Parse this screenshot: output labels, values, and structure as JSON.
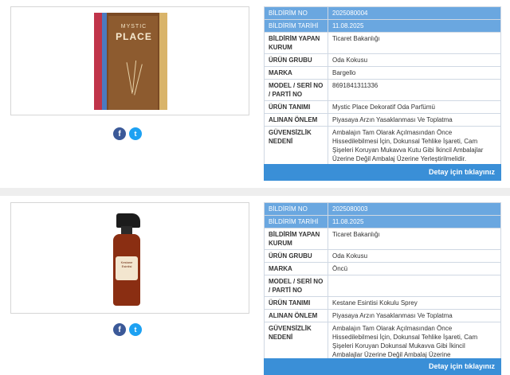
{
  "cards": [
    {
      "fields": [
        {
          "label": "BİLDİRİM NO",
          "value": "2025080004"
        },
        {
          "label": "BİLDİRİM TARİHİ",
          "value": "11.08.2025"
        },
        {
          "label": "BİLDİRİM YAPAN KURUM",
          "value": "Ticaret Bakanlığı"
        },
        {
          "label": "ÜRÜN GRUBU",
          "value": "Oda Kokusu"
        },
        {
          "label": "MARKA",
          "value": "Bargello"
        },
        {
          "label": "MODEL / SERİ NO / PARTİ NO",
          "value": "8691841311336"
        },
        {
          "label": "ÜRÜN TANIMI",
          "value": "Mystic Place Dekoratif Oda Parfümü"
        },
        {
          "label": "ALINAN ÖNLEM",
          "value": "Piyasaya Arzın Yasaklanması Ve Toplatma"
        },
        {
          "label": "GÜVENSİZLİK NEDENİ",
          "value": "Ambalajın Tam Olarak Açılmasından Önce Hissedilebilmesi İçin, Dokunsal Tehlike İşareti, Cam Şişeleri Koruyan Mukavva Kutu Gibi İkincil Ambalajlar Üzerine Değil Ambalaj Üzerine Yerleştirilmelidir."
        }
      ],
      "detail_button": "Detay için tıklayınız",
      "product_text": {
        "line1": "MYSTIC",
        "line2": "PLACE"
      }
    },
    {
      "fields": [
        {
          "label": "BİLDİRİM NO",
          "value": "2025080003"
        },
        {
          "label": "BİLDİRİM TARİHİ",
          "value": "11.08.2025"
        },
        {
          "label": "BİLDİRİM YAPAN KURUM",
          "value": "Ticaret Bakanlığı"
        },
        {
          "label": "ÜRÜN GRUBU",
          "value": "Oda Kokusu"
        },
        {
          "label": "MARKA",
          "value": "Öncü"
        },
        {
          "label": "MODEL / SERİ NO / PARTİ NO",
          "value": ""
        },
        {
          "label": "ÜRÜN TANIMI",
          "value": "Kestane Esintisi Kokulu Sprey"
        },
        {
          "label": "ALINAN ÖNLEM",
          "value": "Piyasaya Arzın Yasaklanması Ve Toplatma"
        },
        {
          "label": "GÜVENSİZLİK NEDENİ",
          "value": "Ambalajın Tam Olarak Açılmasından Önce Hissedilebilmesi İçin, Dokunsal Tehlike İşareti, Cam Şişeleri Koruyan Dokunsal Mukavva Gibi İkincil Ambalajlar Üzerine Değil Ambalaj Üzerine Yerleştirilmelidir."
        }
      ],
      "detail_button": "Detay için tıklayınız",
      "product_text": {
        "label": "Kestane Esintisi"
      }
    }
  ],
  "social": {
    "facebook_glyph": "f",
    "twitter_glyph": "t",
    "icons": [
      "facebook-icon",
      "twitter-icon"
    ]
  },
  "colors": {
    "header_row": "#6aa7e0",
    "button": "#3a8fd7",
    "facebook": "#3b5998",
    "twitter": "#1da1f2"
  }
}
